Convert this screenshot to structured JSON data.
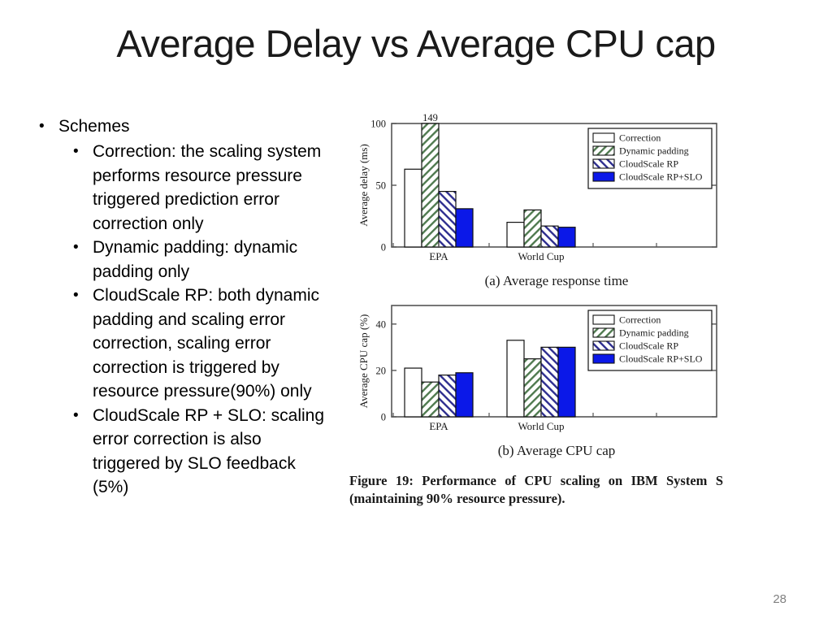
{
  "slide": {
    "title": "Average Delay vs Average CPU cap",
    "page_number": "28"
  },
  "bullets": {
    "heading": "Schemes",
    "items": [
      "Correction: the scaling system performs resource pressure triggered prediction error correction only",
      "Dynamic padding: dynamic padding only",
      "CloudScale RP: both dynamic padding and scaling error correction, scaling error correction is triggered by resource pressure(90%) only",
      "CloudScale RP + SLO: scaling error correction is also triggered by SLO feedback (5%)"
    ]
  },
  "figure": {
    "caption": "Figure 19:  Performance of CPU scaling on IBM System S (maintaining 90% resource pressure).",
    "subcaption_a": "(a)  Average response time",
    "subcaption_b": "(b)  Average CPU cap"
  },
  "colors": {
    "correction_fill": "#ffffff",
    "dynamic_padding_hatch": "#4f7a4f",
    "cloudscale_rp_hatch": "#2d2d8f",
    "cloudscale_rp_slo_fill": "#0b18e8",
    "axis": "#555555",
    "text": "#1a1a1a"
  },
  "chart_data": [
    {
      "type": "bar",
      "id": "chart-a",
      "title": "(a)  Average response time",
      "xlabel": "",
      "ylabel": "Average delay (ms)",
      "categories": [
        "EPA",
        "World Cup"
      ],
      "ylim": [
        0,
        100
      ],
      "yticks": [
        0,
        50,
        100
      ],
      "ytick_labels": [
        "0",
        "50",
        "100"
      ],
      "grid": false,
      "legend_position": "top-right",
      "series": [
        {
          "name": "Correction",
          "values": [
            63,
            20
          ]
        },
        {
          "name": "Dynamic padding",
          "values": [
            149,
            30
          ]
        },
        {
          "name": "CloudScale RP",
          "values": [
            45,
            17
          ]
        },
        {
          "name": "CloudScale RP+SLO",
          "values": [
            31,
            16
          ]
        }
      ],
      "annotations": [
        {
          "text": "149",
          "series": "Dynamic padding",
          "category": "EPA",
          "note": "bar clipped at axis top"
        }
      ]
    },
    {
      "type": "bar",
      "id": "chart-b",
      "title": "(b)  Average CPU cap",
      "xlabel": "",
      "ylabel": "Average CPU cap (%)",
      "categories": [
        "EPA",
        "World Cup"
      ],
      "ylim": [
        0,
        48
      ],
      "yticks": [
        0,
        20,
        40
      ],
      "ytick_labels": [
        "0",
        "20",
        "40"
      ],
      "grid": false,
      "legend_position": "top-right",
      "series": [
        {
          "name": "Correction",
          "values": [
            21,
            33
          ]
        },
        {
          "name": "Dynamic padding",
          "values": [
            15,
            25
          ]
        },
        {
          "name": "CloudScale RP",
          "values": [
            18,
            30
          ]
        },
        {
          "name": "CloudScale RP+SLO",
          "values": [
            19,
            30
          ]
        }
      ],
      "annotations": []
    }
  ],
  "legend": {
    "entries": [
      "Correction",
      "Dynamic padding",
      "CloudScale RP",
      "CloudScale RP+SLO"
    ]
  }
}
